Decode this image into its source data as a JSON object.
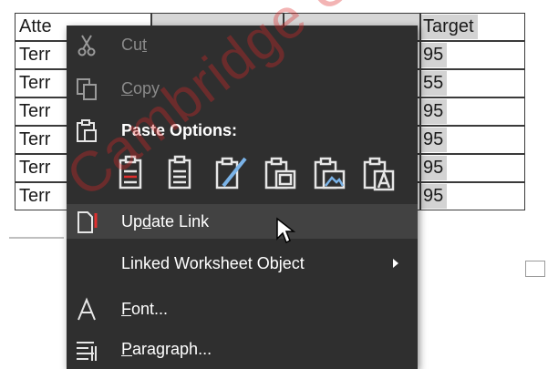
{
  "table": {
    "rows": [
      {
        "name": "Atte",
        "target": "Target"
      },
      {
        "name": "Terr",
        "target": "95"
      },
      {
        "name": "Terr",
        "target": "55"
      },
      {
        "name": "Terr",
        "target": "95"
      },
      {
        "name": "Terr",
        "target": "95"
      },
      {
        "name": "Terr",
        "target": "95"
      },
      {
        "name": "Terr",
        "target": "95"
      }
    ]
  },
  "context_menu": {
    "cut": {
      "label_pre": "Cu",
      "label_u": "t",
      "label_post": "",
      "icon": "scissors-icon",
      "enabled": false
    },
    "copy": {
      "label_pre": "",
      "label_u": "C",
      "label_post": "opy",
      "icon": "copy-icon",
      "enabled": false
    },
    "paste_options": {
      "label": "Paste Options:",
      "icon": "clipboard-icon"
    },
    "paste_buttons": [
      {
        "icon": "keep-source-formatting-icon"
      },
      {
        "icon": "use-destination-styles-icon"
      },
      {
        "icon": "link-keep-source-icon"
      },
      {
        "icon": "link-use-destination-icon"
      },
      {
        "icon": "picture-icon"
      },
      {
        "icon": "keep-text-only-icon"
      }
    ],
    "update_link": {
      "label_pre": "Up",
      "label_u": "d",
      "label_post": "ate Link",
      "icon": "update-link-icon"
    },
    "linked_object": {
      "label": "Linked Worksheet Object",
      "icon": "none"
    },
    "font": {
      "label_pre": "",
      "label_u": "F",
      "label_post": "ont...",
      "icon": "font-icon"
    },
    "paragraph": {
      "label_pre": "",
      "label_u": "P",
      "label_post": "aragraph...",
      "icon": "paragraph-icon"
    }
  },
  "watermark": {
    "text": "Cambridge University"
  },
  "colors": {
    "menu_bg": "#2f2f2f",
    "menu_hover": "#424242",
    "watermark": "#dc2828",
    "accent_red": "#e0302f"
  }
}
